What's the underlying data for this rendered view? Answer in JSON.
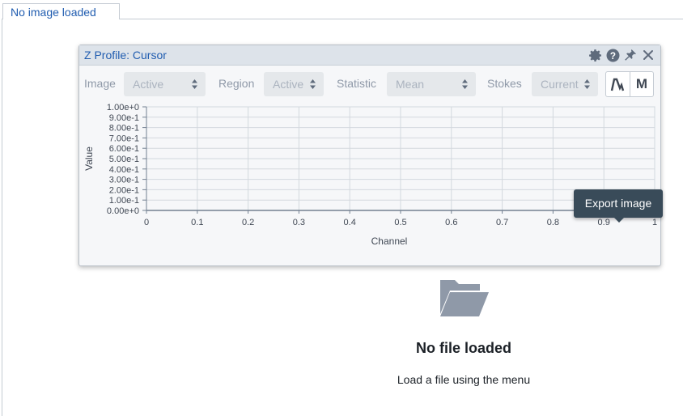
{
  "tabs": [
    {
      "label": "No image loaded"
    }
  ],
  "empty_state": {
    "icon": "folder-open-icon",
    "title": "No file loaded",
    "subtitle": "Load a file using the menu"
  },
  "widget": {
    "title": "Z Profile: Cursor",
    "header_icons": [
      "gear-icon",
      "help-icon",
      "pin-icon",
      "close-icon"
    ],
    "controls": {
      "image": {
        "label": "Image",
        "value": "Active"
      },
      "region": {
        "label": "Region",
        "value": "Active"
      },
      "statistic": {
        "label": "Statistic",
        "value": "Mean"
      },
      "stokes": {
        "label": "Stokes",
        "value": "Current"
      }
    },
    "buttons": {
      "line_icon": "line-plot-icon",
      "moments_label": "M"
    }
  },
  "tooltip": {
    "text": "Export image"
  },
  "chart_data": {
    "type": "line",
    "xlabel": "Channel",
    "ylabel": "Value",
    "xlim": [
      0,
      1
    ],
    "ylim": [
      0,
      1
    ],
    "x_ticks": [
      "0",
      "0.1",
      "0.2",
      "0.3",
      "0.4",
      "0.5",
      "0.6",
      "0.7",
      "0.8",
      "0.9",
      "1"
    ],
    "y_ticks": [
      "0.00e+0",
      "1.00e-1",
      "2.00e-1",
      "3.00e-1",
      "4.00e-1",
      "5.00e-1",
      "6.00e-1",
      "7.00e-1",
      "8.00e-1",
      "9.00e-1",
      "1.00e+0"
    ],
    "series": [],
    "grid": true
  },
  "colors": {
    "accent": "#215db0",
    "header_bg": "#dde3ea",
    "tooltip_bg": "#394b59",
    "folder": "#8f99a8"
  }
}
